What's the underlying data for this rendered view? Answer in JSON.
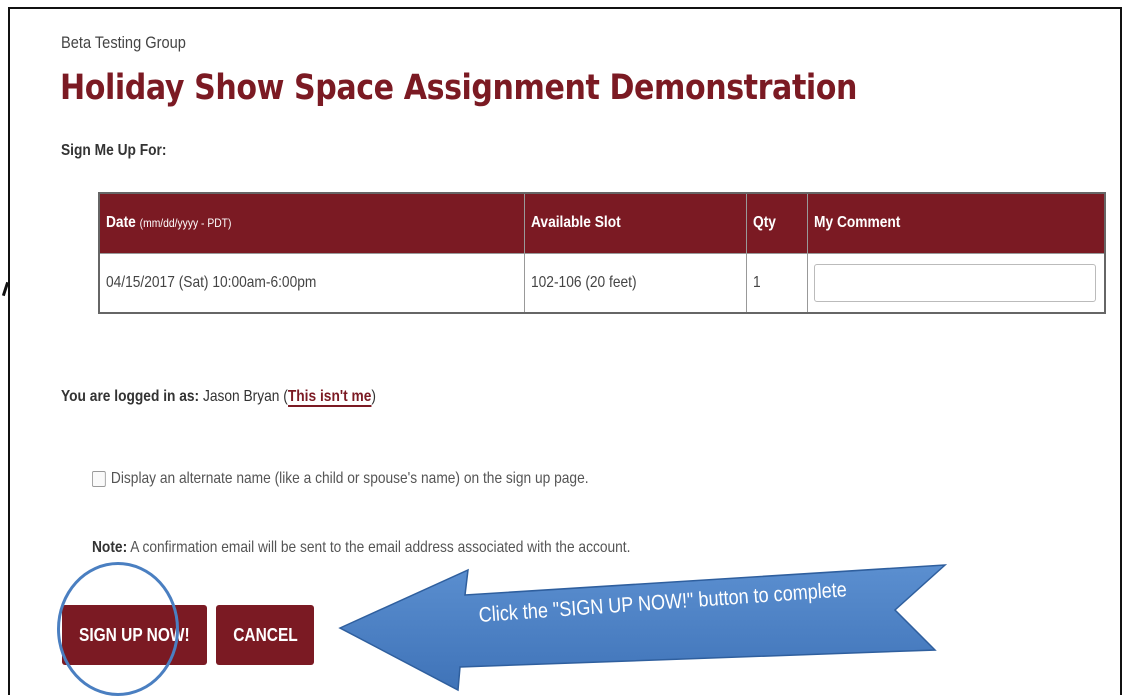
{
  "header": {
    "group_name": "Beta Testing Group",
    "title": "Holiday Show Space Assignment Demonstration"
  },
  "signup_section": {
    "label": "Sign Me Up For:"
  },
  "table": {
    "columns": {
      "date": "Date",
      "date_format": "(mm/dd/yyyy - PDT)",
      "slot": "Available Slot",
      "qty": "Qty",
      "comment": "My Comment"
    },
    "rows": [
      {
        "date": "04/15/2017 (Sat) 10:00am-6:00pm",
        "slot": "102-106 (20 feet)",
        "qty": "1",
        "comment_value": ""
      }
    ]
  },
  "login": {
    "prefix": "You are logged in as:",
    "user_name": "Jason Bryan",
    "open_paren": "(",
    "not_me_link": "This isn't me",
    "close_paren": ")"
  },
  "alternate_name": {
    "label": "Display an alternate name (like a child or spouse's name) on the sign up page.",
    "checked": false
  },
  "note": {
    "label": "Note:",
    "text": "A confirmation email will be sent to the email address associated with the account."
  },
  "buttons": {
    "signup": "SIGN UP NOW!",
    "cancel": "CANCEL"
  },
  "annotation": {
    "callout_text": "Click the \"SIGN UP NOW!\" button to complete",
    "arrow_color": "#4a7fc1",
    "circle_color": "#4a7fc1"
  },
  "colors": {
    "brand": "#7b1a23"
  }
}
